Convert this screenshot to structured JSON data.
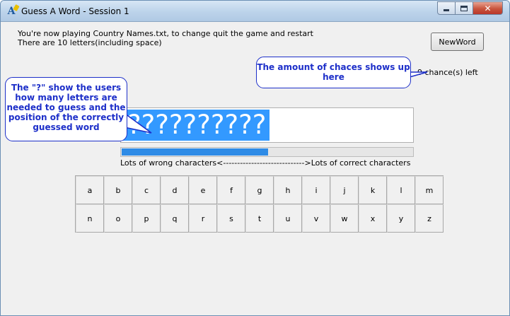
{
  "window": {
    "title": "Guess A Word - Session 1",
    "icon": "app-letter-icon",
    "controls": {
      "minimize": "minimize-icon",
      "maximize": "maximize-icon",
      "close": "close-icon",
      "close_glyph": "✕"
    }
  },
  "info": {
    "line1": "You're now playing Country Names.txt, to change quit the game and restart",
    "line2": "There are 10 letters(including space)"
  },
  "newword_label": "NewWord",
  "chances_text": "9 chance(s) left",
  "callouts": {
    "chances_line1": "The amount of chaces shows up",
    "chances_line2": "here",
    "word_line1": "The \"?\" show the users",
    "word_line2": "how many letters are",
    "word_line3": "needed to guess and the",
    "word_line4": "position of the correctly",
    "word_line5": "guessed word"
  },
  "word_display": "??????????",
  "progress": {
    "value": 0.5,
    "label": "Lots of wrong characters<------------------------------------------------------------------------------------------------------------------------------------------------------------------------------------------------------------------------------------------------------------------------------------------------------------------------------------------------------>Lots of correct characters"
  },
  "letters": [
    "a",
    "b",
    "c",
    "d",
    "e",
    "f",
    "g",
    "h",
    "i",
    "j",
    "k",
    "l",
    "m",
    "n",
    "o",
    "p",
    "q",
    "r",
    "s",
    "t",
    "u",
    "v",
    "w",
    "x",
    "y",
    "z"
  ],
  "colors": {
    "callout": "#1d2fc9",
    "selection": "#3399ff",
    "progress": "#2e8be6"
  }
}
